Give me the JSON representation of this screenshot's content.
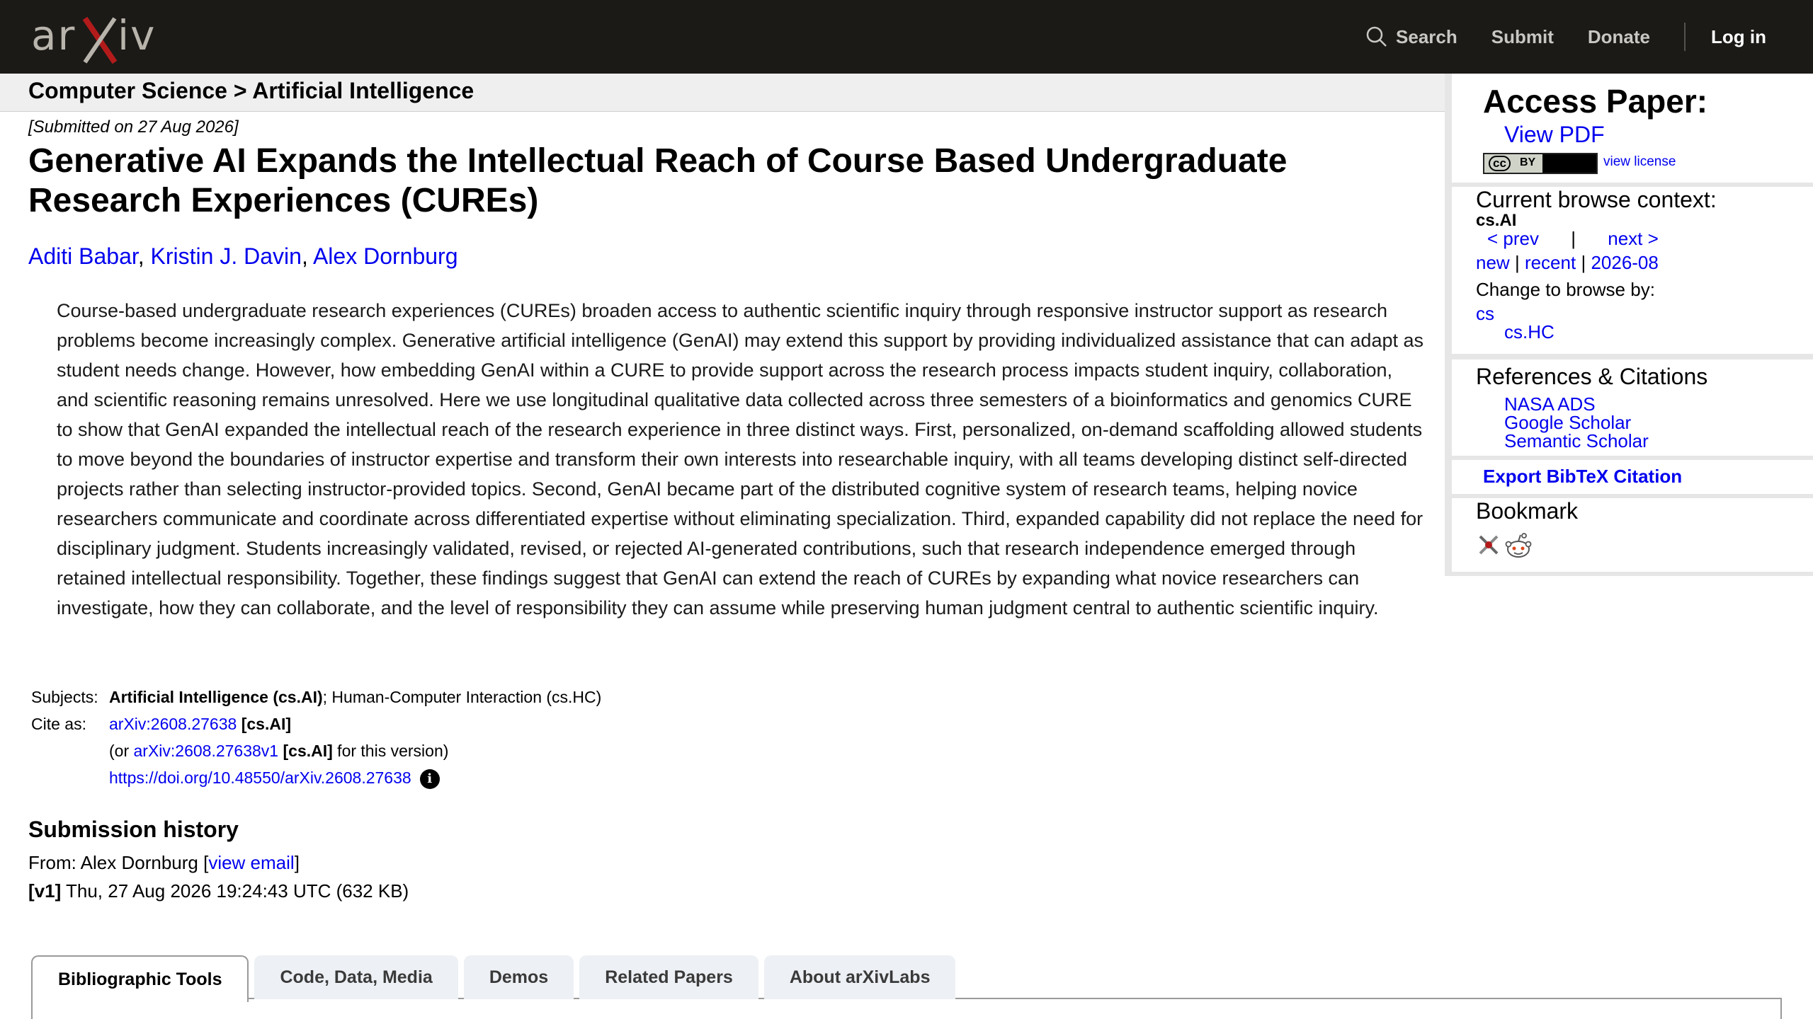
{
  "brand": {
    "logo_text": "arXiv"
  },
  "nav": {
    "search": "Search",
    "submit": "Submit",
    "donate": "Donate",
    "login": "Log in"
  },
  "breadcrumb": "Computer Science > Artificial Intelligence",
  "paper": {
    "submitted": "[Submitted on 27 Aug 2026]",
    "title": "Generative AI Expands the Intellectual Reach of Course Based Undergraduate Research Experiences (CUREs)",
    "authors": [
      "Aditi Babar",
      "Kristin J. Davin",
      "Alex Dornburg"
    ],
    "abstract": "Course-based undergraduate research experiences (CUREs) broaden access to authentic scientific inquiry through responsive instructor support as research problems become increasingly complex. Generative artificial intelligence (GenAI) may extend this support by providing individualized assistance that can adapt as student needs change. However, how embedding GenAI within a CURE to provide support across the research process impacts student inquiry, collaboration, and scientific reasoning remains unresolved. Here we use longitudinal qualitative data collected across three semesters of a bioinformatics and genomics CURE to show that GenAI expanded the intellectual reach of the research experience in three distinct ways. First, personalized, on-demand scaffolding allowed students to move beyond the boundaries of instructor expertise and transform their own interests into researchable inquiry, with all teams developing distinct self-directed projects rather than selecting instructor-provided topics. Second, GenAI became part of the distributed cognitive system of research teams, helping novice researchers communicate and coordinate across differentiated expertise without eliminating specialization. Third, expanded capability did not replace the need for disciplinary judgment. Students increasingly validated, revised, or rejected AI-generated contributions, such that research independence emerged through retained intellectual responsibility. Together, these findings suggest that GenAI can extend the reach of CUREs by expanding what novice researchers can investigate, how they can collaborate, and the level of responsibility they can assume while preserving human judgment central to authentic scientific inquiry."
  },
  "meta": {
    "subjects_label": "Subjects:",
    "subject_primary": "Artificial Intelligence (cs.AI)",
    "subject_secondary": "; Human-Computer Interaction (cs.HC)",
    "cite_label": "Cite as:",
    "cite_id": "arXiv:2608.27638",
    "cite_cat": " [cs.AI]",
    "or_prefix": "(or ",
    "version_id": "arXiv:2608.27638v1",
    "version_cat": " [cs.AI]",
    "version_suffix": " for this version)",
    "doi": "https://doi.org/10.48550/arXiv.2608.27638",
    "info_icon": "i"
  },
  "history": {
    "heading": "Submission history",
    "from_prefix": "From: Alex Dornburg [",
    "view_email": "view email",
    "from_suffix": "]",
    "v1_label": "[v1]",
    "v1_text": " Thu, 27 Aug 2026 19:24:43 UTC (632 KB)"
  },
  "tabs": [
    "Bibliographic Tools",
    "Code, Data, Media",
    "Demos",
    "Related Papers",
    "About arXivLabs"
  ],
  "sidebar": {
    "access_heading": "Access Paper:",
    "view_pdf": "View PDF",
    "cc_text": "cc",
    "cc_by": "BY",
    "view_license": "view license",
    "context_heading": "Current browse context:",
    "context_cat": "cs.AI",
    "prev": "< prev",
    "sep": "|",
    "next": "next >",
    "new": "new",
    "recent": "recent",
    "month": "2026-08",
    "change_label": "Change to browse by:",
    "browse_cs": "cs",
    "browse_cshc": "cs.HC",
    "refs_heading": "References & Citations",
    "nasa_ads": "NASA ADS",
    "google_scholar": "Google Scholar",
    "semantic_scholar": "Semantic Scholar",
    "export_bibtex": "Export BibTeX Citation",
    "bookmark_heading": "Bookmark"
  }
}
